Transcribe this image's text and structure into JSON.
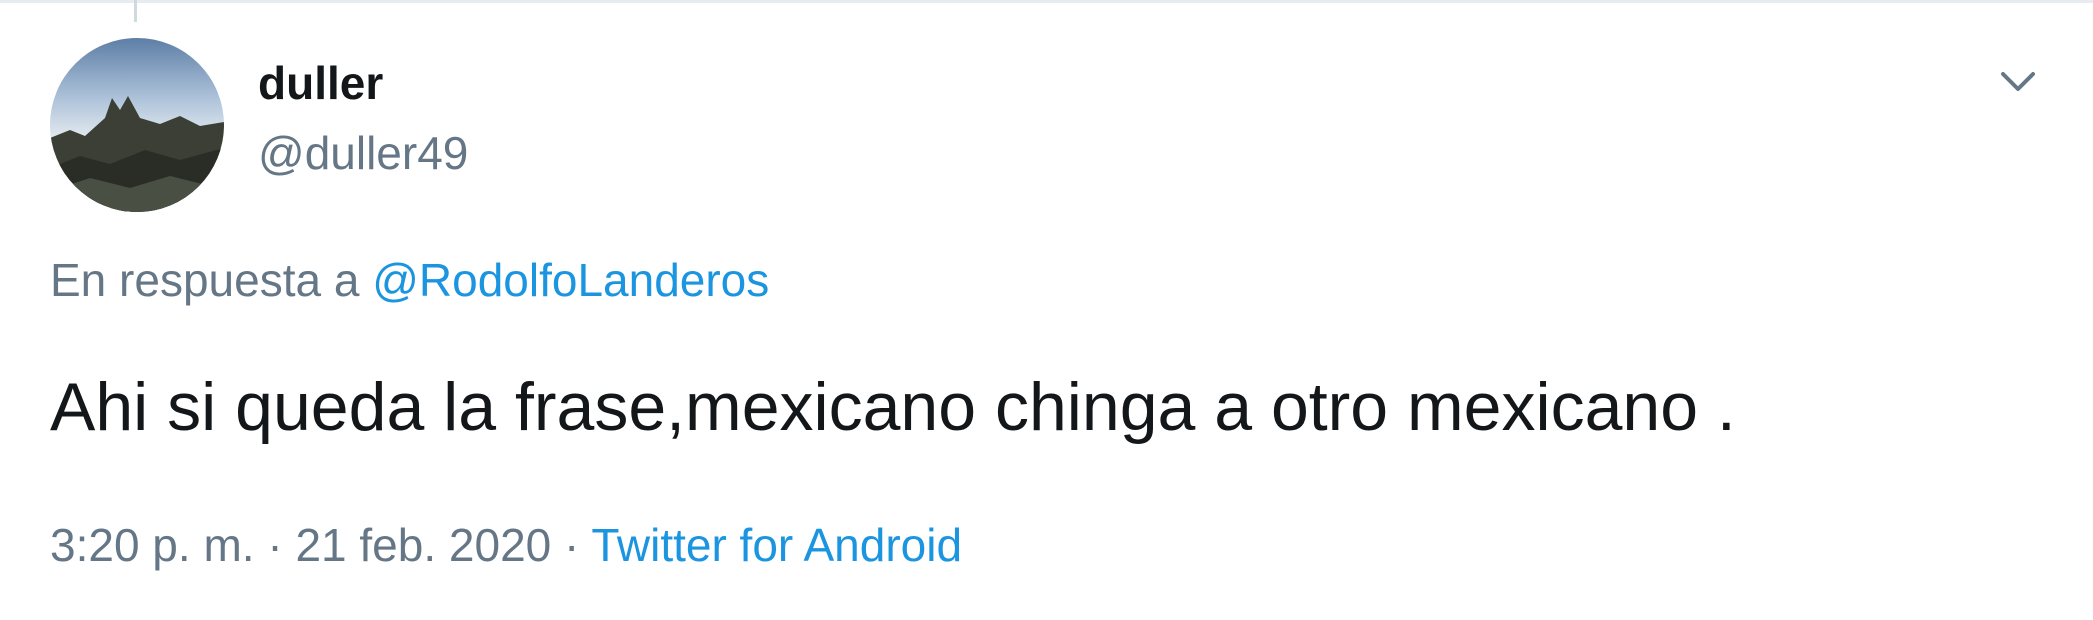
{
  "tweet": {
    "display_name": "duller",
    "handle": "@duller49",
    "reply_prefix": "En respuesta a",
    "reply_to": "@RodolfoLanderos",
    "text": "Ahi si queda la frase,mexicano chinga a otro mexicano .",
    "time": "3:20 p. m.",
    "separator": "·",
    "date": "21 feb. 2020",
    "source": "Twitter for Android"
  },
  "icons": {
    "menu": "chevron-down-icon",
    "avatar": "profile-photo-landscape"
  },
  "colors": {
    "link": "#1b95e0",
    "text": "#14171a",
    "muted": "#657786"
  }
}
